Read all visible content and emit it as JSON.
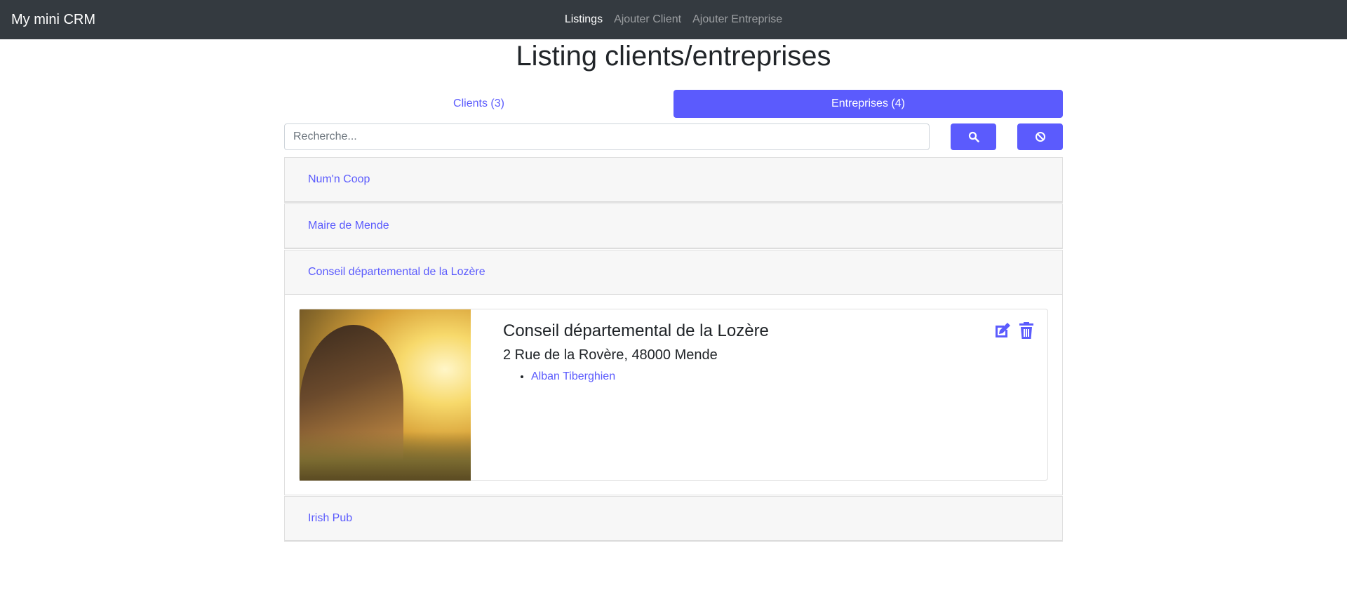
{
  "navbar": {
    "brand": "My mini CRM",
    "links": [
      {
        "label": "Listings",
        "active": true
      },
      {
        "label": "Ajouter Client",
        "active": false
      },
      {
        "label": "Ajouter Entreprise",
        "active": false
      }
    ]
  },
  "page_title": "Listing clients/entreprises",
  "tabs": [
    {
      "label": "Clients (3)",
      "active": false
    },
    {
      "label": "Entreprises (4)",
      "active": true
    }
  ],
  "search": {
    "placeholder": "Recherche...",
    "search_icon": "search-icon",
    "reset_icon": "ban-icon"
  },
  "entreprises": [
    {
      "name": "Num'n Coop"
    },
    {
      "name": "Maire de Mende"
    },
    {
      "name": "Conseil départemental de la Lozère"
    },
    {
      "name": "Irish Pub"
    }
  ],
  "expanded": {
    "title": "Conseil départemental de la Lozère",
    "address": "2 Rue de la Rovère, 48000 Mende",
    "contacts": [
      "Alban Tiberghien"
    ],
    "edit_icon": "edit-icon",
    "delete_icon": "trash-icon"
  },
  "colors": {
    "accent": "#5b5bfd",
    "navbar": "#343a40"
  }
}
